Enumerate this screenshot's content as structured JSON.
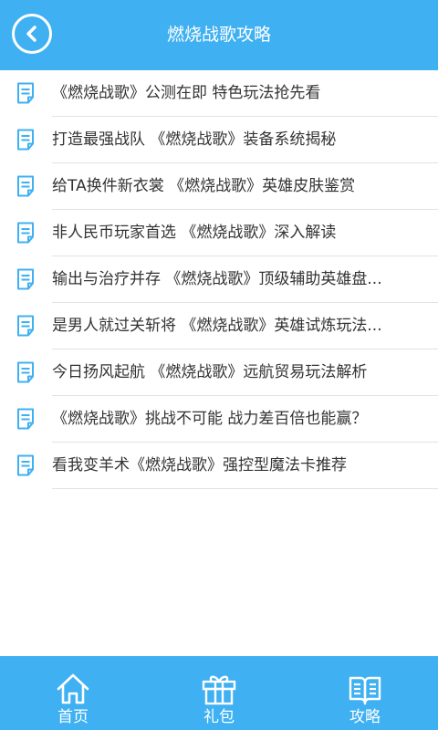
{
  "header": {
    "title": "燃烧战歌攻略",
    "back_icon": "chevron-left-icon"
  },
  "articles": [
    {
      "title": "《燃烧战歌》公测在即 特色玩法抢先看"
    },
    {
      "title": "打造最强战队 《燃烧战歌》装备系统揭秘"
    },
    {
      "title": "给TA换件新衣裳 《燃烧战歌》英雄皮肤鉴赏"
    },
    {
      "title": "非人民币玩家首选 《燃烧战歌》深入解读"
    },
    {
      "title": "输出与治疗并存 《燃烧战歌》顶级辅助英雄盘..."
    },
    {
      "title": "是男人就过关斩将 《燃烧战歌》英雄试炼玩法..."
    },
    {
      "title": "今日扬风起航 《燃烧战歌》远航贸易玩法解析"
    },
    {
      "title": "《燃烧战歌》挑战不可能 战力差百倍也能赢？"
    },
    {
      "title": "看我变羊术《燃烧战歌》强控型魔法卡推荐"
    }
  ],
  "tabbar": {
    "home_label": "首页",
    "gift_label": "礼包",
    "guide_label": "攻略"
  },
  "colors": {
    "accent": "#3fb0f2",
    "text": "#333333",
    "divider": "#e2e2e2"
  }
}
